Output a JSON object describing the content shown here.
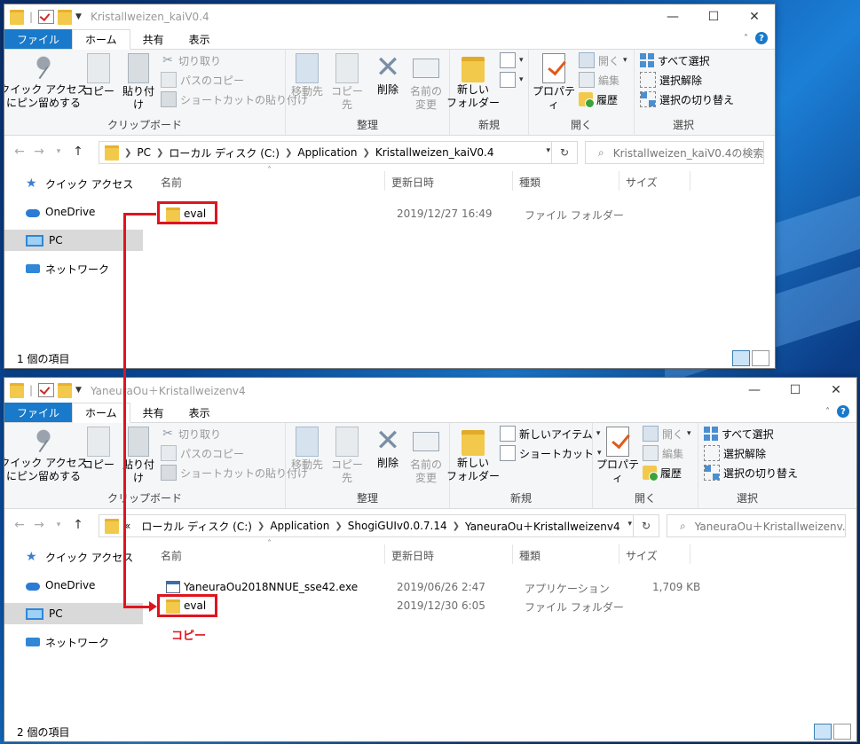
{
  "window1": {
    "title": "Kristallweizen_kaiV0.4",
    "tabs": {
      "file": "ファイル",
      "home": "ホーム",
      "share": "共有",
      "view": "表示"
    },
    "ribbon": {
      "pin": "クイック アクセス\nにピン留めする",
      "copy": "コピー",
      "paste": "貼り付け",
      "cut": "切り取り",
      "copy_path": "パスのコピー",
      "paste_shortcut": "ショートカットの貼り付け",
      "clipboard": "クリップボード",
      "move_to": "移動先",
      "copy_to": "コピー先",
      "delete": "削除",
      "rename": "名前の\n変更",
      "organize": "整理",
      "new_folder": "新しい\nフォルダー",
      "new": "新規",
      "properties": "プロパティ",
      "open": "開く",
      "edit": "編集",
      "history": "履歴",
      "open_group": "開く",
      "select_all": "すべて選択",
      "select_none": "選択解除",
      "invert": "選択の切り替え",
      "select_group": "選択"
    },
    "address": [
      "PC",
      "ローカル ディスク (C:)",
      "Application",
      "Kristallweizen_kaiV0.4"
    ],
    "search_placeholder": "Kristallweizen_kaiV0.4の検索",
    "nav": [
      "クイック アクセス",
      "OneDrive",
      "PC",
      "ネットワーク"
    ],
    "columns": [
      "名前",
      "更新日時",
      "種類",
      "サイズ"
    ],
    "rows": [
      {
        "name": "eval",
        "date": "2019/12/27 16:49",
        "type": "ファイル フォルダー",
        "size": ""
      }
    ],
    "status": "1 個の項目"
  },
  "window2": {
    "title": "YaneuraOu＋Kristallweizenv4",
    "tabs": {
      "file": "ファイル",
      "home": "ホーム",
      "share": "共有",
      "view": "表示"
    },
    "ribbon": {
      "pin": "クイック アクセス\nにピン留めする",
      "copy": "コピー",
      "paste": "貼り付け",
      "cut": "切り取り",
      "copy_path": "パスのコピー",
      "paste_shortcut": "ショートカットの貼り付け",
      "clipboard": "クリップボード",
      "move_to": "移動先",
      "copy_to": "コピー先",
      "delete": "削除",
      "rename": "名前の\n変更",
      "organize": "整理",
      "new_item": "新しいアイテム",
      "easy_access": "ショートカット",
      "new_folder": "新しい\nフォルダー",
      "new": "新規",
      "properties": "プロパティ",
      "open": "開く",
      "edit": "編集",
      "history": "履歴",
      "open_group": "開く",
      "select_all": "すべて選択",
      "select_none": "選択解除",
      "invert": "選択の切り替え",
      "select_group": "選択"
    },
    "address": [
      "«",
      "ローカル ディスク (C:)",
      "Application",
      "ShogiGUIv0.0.7.14",
      "YaneuraOu＋Kristallweizenv4"
    ],
    "search_placeholder": "YaneuraOu＋Kristallweizenv...",
    "nav": [
      "クイック アクセス",
      "OneDrive",
      "PC",
      "ネットワーク"
    ],
    "columns": [
      "名前",
      "更新日時",
      "種類",
      "サイズ"
    ],
    "rows": [
      {
        "name": "YaneuraOu2018NNUE_sse42.exe",
        "date": "2019/06/26 2:47",
        "type": "アプリケーション",
        "size": "1,709 KB"
      },
      {
        "name": "eval",
        "date": "2019/12/30 6:05",
        "type": "ファイル フォルダー",
        "size": ""
      }
    ],
    "status": "2 個の項目"
  },
  "annotation": {
    "copy_label": "コピー",
    "color": "#e0141e"
  },
  "colors": {
    "file_tab": "#1979ca",
    "folder": "#f3c94c",
    "highlight": "#e0141e"
  }
}
